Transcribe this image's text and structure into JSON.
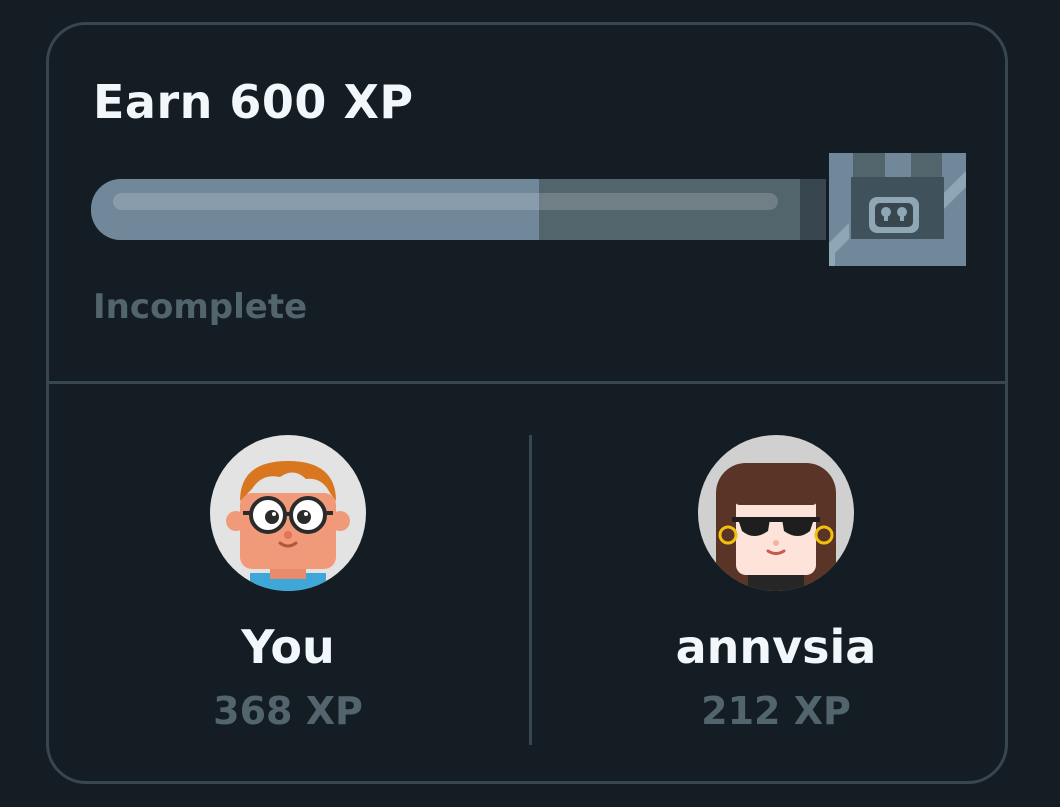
{
  "quest": {
    "title": "Earn 600 XP",
    "status": "Incomplete",
    "progress_fraction": 0.61,
    "reward_icon": "chest-icon"
  },
  "players": [
    {
      "name": "You",
      "xp": "368 XP",
      "avatar": "avatar-glasses-boy"
    },
    {
      "name": "annvsia",
      "xp": "212 XP",
      "avatar": "avatar-sunglasses-girl"
    }
  ],
  "colors": {
    "background": "#141d23",
    "border": "#37464f",
    "progress_fill": "#70889a",
    "progress_track": "#52656d",
    "text_primary": "#f1f7fb",
    "text_muted": "#52656d"
  }
}
